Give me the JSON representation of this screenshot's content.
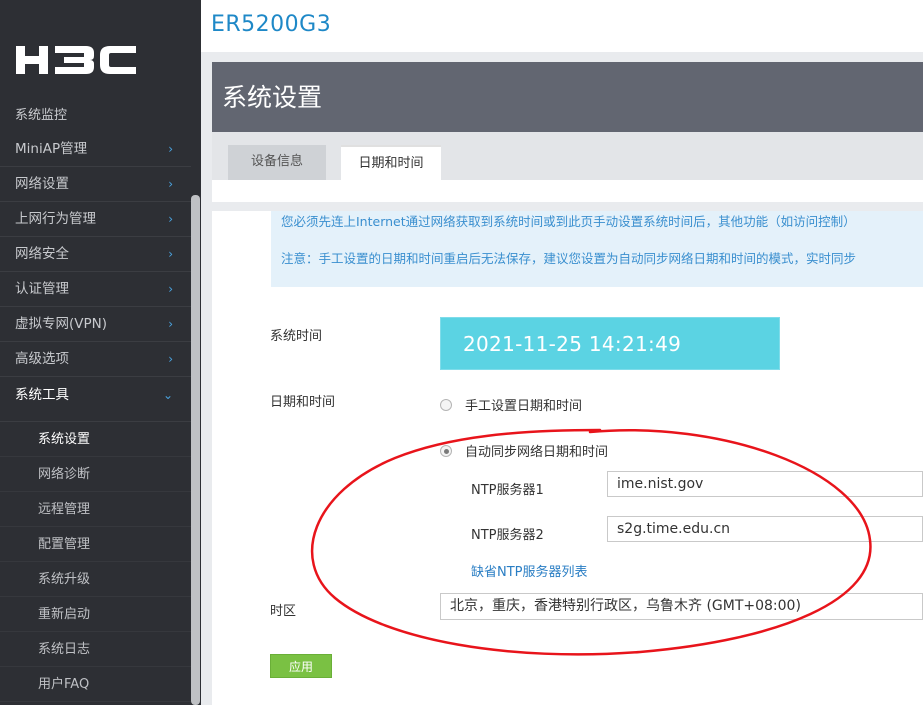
{
  "brand": {
    "logo_text": "H3C"
  },
  "header": {
    "device_name": "ER5200G3"
  },
  "sidebar": {
    "partial_item": "系统监控",
    "items": [
      {
        "label": "MiniAP管理",
        "arrow": "›"
      },
      {
        "label": "网络设置",
        "arrow": "›"
      },
      {
        "label": "上网行为管理",
        "arrow": "›"
      },
      {
        "label": "网络安全",
        "arrow": "›"
      },
      {
        "label": "认证管理",
        "arrow": "›"
      },
      {
        "label": "虚拟专网(VPN)",
        "arrow": "›"
      },
      {
        "label": "高级选项",
        "arrow": "›"
      },
      {
        "label": "系统工具",
        "arrow": "⌄"
      }
    ],
    "subitems": [
      {
        "label": "系统设置"
      },
      {
        "label": "网络诊断"
      },
      {
        "label": "远程管理"
      },
      {
        "label": "配置管理"
      },
      {
        "label": "系统升级"
      },
      {
        "label": "重新启动"
      },
      {
        "label": "系统日志"
      },
      {
        "label": "用户FAQ"
      }
    ]
  },
  "page": {
    "title": "系统设置",
    "tabs": [
      {
        "label": "设备信息"
      },
      {
        "label": "日期和时间"
      }
    ]
  },
  "notice": {
    "line1": "您必须先连上Internet通过网络获取到系统时间或到此页手动设置系统时间后，其他功能（如访问控制）",
    "line2": "注意：手工设置的日期和时间重启后无法保存，建议您设置为自动同步网络日期和时间的模式，实时同步"
  },
  "form": {
    "system_time_label": "系统时间",
    "system_time_value": "2021-11-25 14:21:49",
    "datetime_label": "日期和时间",
    "manual_option": "手工设置日期和时间",
    "auto_option": "自动同步网络日期和时间",
    "ntp1_label": "NTP服务器1",
    "ntp1_value": "ime.nist.gov",
    "ntp2_label": "NTP服务器2",
    "ntp2_value": "s2g.time.edu.cn",
    "default_ntp_link": "缺省NTP服务器列表",
    "timezone_label": "时区",
    "timezone_value": "北京，重庆，香港特别行政区，乌鲁木齐 (GMT+08:00)",
    "apply_label": "应用"
  },
  "colors": {
    "accent": "#1e88c7",
    "time_display": "#5bd3e3",
    "apply_button": "#7ac143",
    "annotation": "#e8141b"
  }
}
